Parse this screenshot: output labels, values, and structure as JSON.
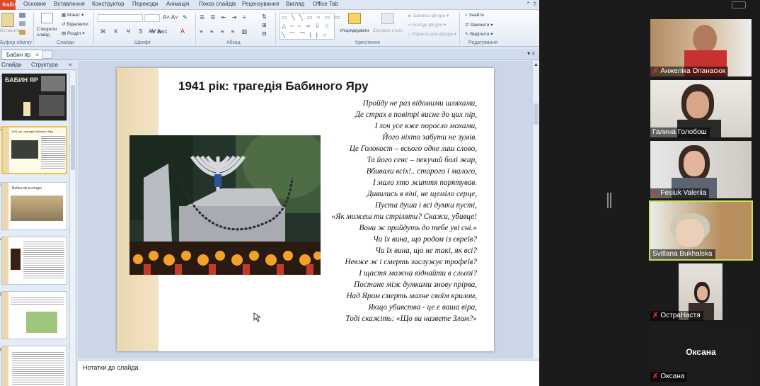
{
  "ribbon": {
    "file_tab": "Файл",
    "tabs": [
      "Основне",
      "Вставлення",
      "Конструктор",
      "Переходи",
      "Анімація",
      "Показ слайдів",
      "Рецензування",
      "Вигляд",
      "Office Tab"
    ],
    "groups": [
      "Буфер обміну",
      "Слайди",
      "Шрифт",
      "Абзац",
      "Креслення",
      "Редагування"
    ],
    "clipboard_paste": "Вставити",
    "new_slide": "Створити слайд",
    "layout": "Макет",
    "reset": "Відновити",
    "section": "Розділ",
    "arrange": "Упорядкувати",
    "quick_styles": "Експрес-стилі",
    "shape_fill": "Заливка фігури",
    "shape_outline": "Контур фігури",
    "shape_effects": "Ефекти для фігури",
    "find": "Знайти",
    "replace": "Замінити",
    "select": "Виділити"
  },
  "document": {
    "tab_title": "Бабин яр"
  },
  "slide_panel": {
    "tab_slides": "Слайди",
    "tab_outline": "Структура",
    "numbers": [
      "1",
      "2",
      "3",
      "4",
      "5",
      "6"
    ],
    "thumb_titles": [
      "БАБИН ЯР",
      "1941 рік: трагедія Бабиного Яру",
      "Бабин яр сьогодні",
      "",
      "",
      ""
    ]
  },
  "slide": {
    "title": "1941 рік: трагедія Бабиного Яру",
    "poem": [
      "Пройду не раз відомими шляхами,",
      "Де страх в повітрі висне до цих пір,",
      "І хоч усе вже поросло мохами,",
      "Його ніхто забути не зумів.",
      "Це Голокост – всього одне лиш слово,",
      "Та його сенс – пекучий болі жар,",
      "Вбивали всіх!.. старого і малого,",
      "І мало хто життя порятував.",
      "Дивились в вічі, не щеміло серце,",
      "Пуста душа і всі думки пусті,",
      "«Як можеш ти стріляти? Скажи, убивце!",
      "Вони ж прийдуть до тебе уві сні.»",
      "Чи їх вина, що родом із євреїв?",
      "Чи їх вина, що не такі, як всі?",
      "Невже ж і смерть заслужує трофеїв?",
      "І щастя можна віднайти в сльозі?",
      "Постане між думками знову прірва,",
      "Над Яром смерть махне своїм крилом,",
      "Якщо убивства - це є ваша віра,",
      "Тоді скажіть:  «Що ви назвете Злом?»"
    ]
  },
  "notes": {
    "label": "Нотатки до слайда"
  },
  "participants": [
    {
      "name": "Анжеліка Опанасюк",
      "muted": true,
      "active": false
    },
    {
      "name": "Галина Голобош",
      "muted": false,
      "active": false
    },
    {
      "name": "Fesiuk Valeriia",
      "muted": true,
      "active": false
    },
    {
      "name": "Svitlana Bukhalska",
      "muted": false,
      "active": true
    },
    {
      "name": "ОстраНастя",
      "muted": true,
      "active": false
    },
    {
      "name": "Оксана",
      "muted": true,
      "active": false,
      "center_label": "Оксана"
    }
  ],
  "colors": {
    "accent_file": "#d9482b",
    "active_speaker": "#c8e05a",
    "slide_stripe": "#ecd7ae"
  }
}
